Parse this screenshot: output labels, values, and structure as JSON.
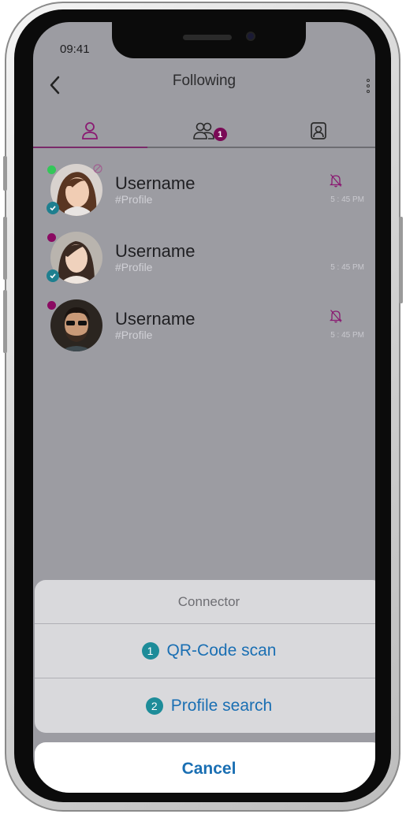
{
  "status_bar": {
    "time": "09:41"
  },
  "header": {
    "title": "Following"
  },
  "tabs": [
    {
      "name": "following",
      "icon": "person-icon",
      "active": true
    },
    {
      "name": "groups",
      "icon": "group-icon",
      "badge": "1"
    },
    {
      "name": "contacts",
      "icon": "contact-card-icon"
    }
  ],
  "contacts": [
    {
      "username": "Username",
      "profile": "#Profile",
      "time": "5 : 45 PM",
      "muted": true,
      "status_color": "#34c759",
      "verified": true,
      "blocked": true
    },
    {
      "username": "Username",
      "profile": "#Profile",
      "time": "5 : 45 PM",
      "muted": false,
      "status_color": "#8a0a62",
      "verified": true,
      "blocked": false
    },
    {
      "username": "Username",
      "profile": "#Profile",
      "time": "5 : 45 PM",
      "muted": true,
      "status_color": "#8a0a62",
      "verified": false,
      "blocked": false
    }
  ],
  "action_sheet": {
    "title": "Connector",
    "options": [
      {
        "number": "1",
        "label": "QR-Code scan"
      },
      {
        "number": "2",
        "label": "Profile search"
      }
    ],
    "cancel_label": "Cancel"
  },
  "colors": {
    "accent": "#7a0a56",
    "link": "#1a6fb3",
    "teal": "#1d8c99"
  }
}
